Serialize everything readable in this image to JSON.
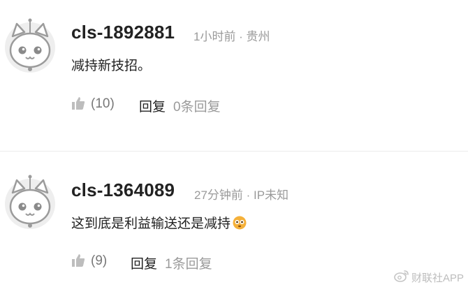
{
  "comments": [
    {
      "username": "cls-1892881",
      "meta": "1小时前 · 贵州",
      "content": "减持新技招。",
      "like_count": "(10)",
      "reply_label": "回复",
      "reply_count": "0条回复"
    },
    {
      "username": "cls-1364089",
      "meta": "27分钟前 · IP未知",
      "content": "这到底是利益输送还是减持",
      "emoji": "flushed-face-emoji",
      "like_count": "(9)",
      "reply_label": "回复",
      "reply_count": "1条回复"
    }
  ],
  "watermark": {
    "text": "财联社APP",
    "icon": "weibo-icon"
  },
  "colors": {
    "text": "#222222",
    "muted": "#9a9a9a",
    "avatar_bg": "#eeeeee",
    "divider": "#ececec",
    "emoji": "#f5b13a"
  }
}
